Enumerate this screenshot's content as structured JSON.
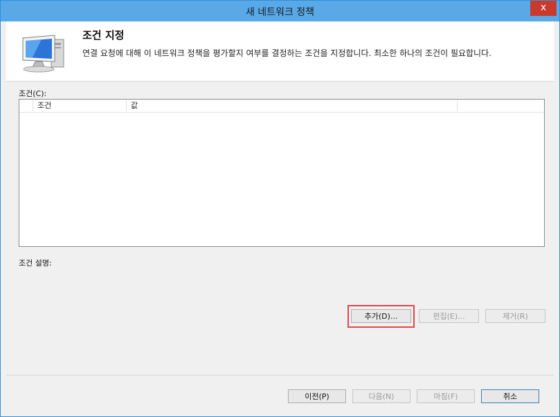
{
  "window": {
    "title": "새 네트워크 정책",
    "close_label": "x"
  },
  "header": {
    "section_title": "조건 지정",
    "description": "연결 요청에 대해 이 네트워크 정책을 평가할지 여부를 결정하는 조건을 지정합니다. 최소한 하나의 조건이 필요합니다.",
    "icon": "computer-network-icon"
  },
  "conditions": {
    "label": "조건(C):",
    "columns": [
      "조건",
      "값"
    ],
    "rows": []
  },
  "condition_description": {
    "label": "조건 설명:"
  },
  "actions": {
    "add": "추가(D)...",
    "edit": "편집(E)...",
    "remove": "제거(R)"
  },
  "footer": {
    "previous": "이전(P)",
    "next": "다음(N)",
    "finish": "마침(F)",
    "cancel": "취소"
  },
  "colors": {
    "titlebar": "#59a9e8",
    "close": "#c83a2e",
    "highlight": "#e0464a"
  }
}
